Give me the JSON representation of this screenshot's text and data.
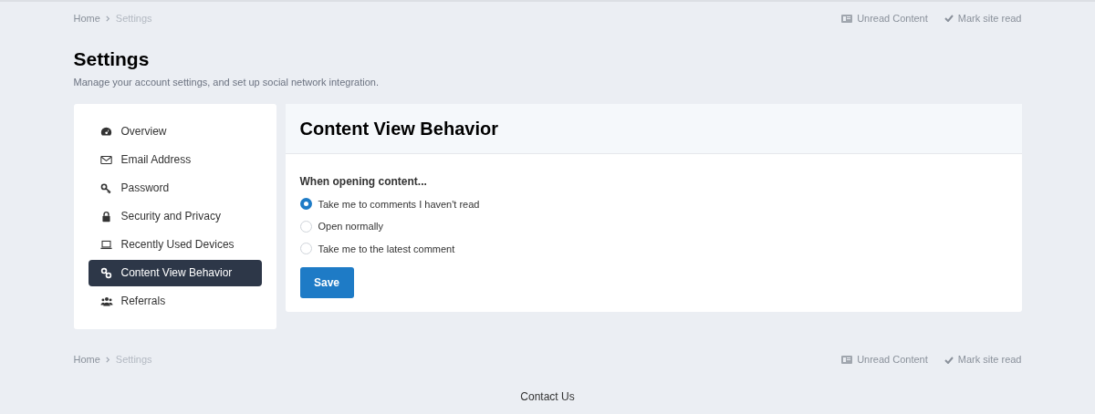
{
  "breadcrumb_top": {
    "items": [
      "Home",
      "Settings"
    ],
    "actions": [
      {
        "kind": "unread",
        "label": "Unread Content"
      },
      {
        "kind": "mark",
        "label": "Mark site read"
      }
    ]
  },
  "page": {
    "title": "Settings",
    "subtitle": "Manage your account settings, and set up social network integration."
  },
  "sidebar": {
    "items": [
      {
        "kind": "gauge",
        "label": "Overview",
        "selected": false
      },
      {
        "kind": "envelope",
        "label": "Email Address",
        "selected": false
      },
      {
        "kind": "key",
        "label": "Password",
        "selected": false
      },
      {
        "kind": "lock",
        "label": "Security and Privacy",
        "selected": false
      },
      {
        "kind": "laptop",
        "label": "Recently Used Devices",
        "selected": false
      },
      {
        "kind": "link",
        "label": "Content View Behavior",
        "selected": true
      },
      {
        "kind": "users",
        "label": "Referrals",
        "selected": false
      }
    ]
  },
  "panel": {
    "title": "Content View Behavior",
    "question": "When opening content...",
    "options": [
      {
        "label": "Take me to comments I haven't read",
        "selected": true
      },
      {
        "label": "Open normally",
        "selected": false
      },
      {
        "label": "Take me to the latest comment",
        "selected": false
      }
    ],
    "button": "Save"
  },
  "breadcrumb_bottom": {
    "items": [
      "Home",
      "Settings"
    ],
    "actions": [
      {
        "kind": "unread",
        "label": "Unread Content"
      },
      {
        "kind": "mark",
        "label": "Mark site read"
      }
    ]
  },
  "footer": {
    "link": "Contact Us"
  }
}
